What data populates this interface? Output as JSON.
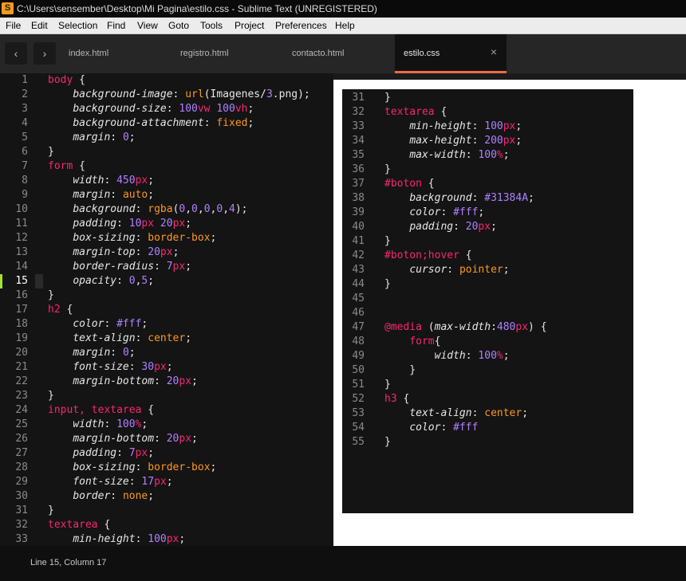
{
  "window": {
    "title": "C:\\Users\\sensember\\Desktop\\Mi Pagina\\estilo.css - Sublime Text (UNREGISTERED)",
    "icon": "sublime-icon"
  },
  "menu": [
    "File",
    "Edit",
    "Selection",
    "Find",
    "View",
    "Goto",
    "Tools",
    "Project",
    "Preferences",
    "Help"
  ],
  "nav": {
    "back": "‹",
    "forward": "›"
  },
  "tabs": [
    {
      "label": "index.html",
      "active": false
    },
    {
      "label": "registro.html",
      "active": false
    },
    {
      "label": "contacto.html",
      "active": false
    },
    {
      "label": "estilo.css",
      "active": true
    }
  ],
  "tab_close": "×",
  "editor": {
    "current_line": 15,
    "lines": [
      {
        "n": "1",
        "code": "body {"
      },
      {
        "n": "2",
        "code": "    background-image: url(Imagenes/3.png);"
      },
      {
        "n": "3",
        "code": "    background-size: 100vw 100vh;"
      },
      {
        "n": "4",
        "code": "    background-attachment: fixed;"
      },
      {
        "n": "5",
        "code": "    margin: 0;"
      },
      {
        "n": "6",
        "code": "}"
      },
      {
        "n": "7",
        "code": "form {"
      },
      {
        "n": "8",
        "code": "    width: 450px;"
      },
      {
        "n": "9",
        "code": "    margin: auto;"
      },
      {
        "n": "10",
        "code": "    background: rgba(0,0,0,0,4);"
      },
      {
        "n": "11",
        "code": "    padding: 10px 20px;"
      },
      {
        "n": "12",
        "code": "    box-sizing: border-box;"
      },
      {
        "n": "13",
        "code": "    margin-top: 20px;"
      },
      {
        "n": "14",
        "code": "    border-radius: 7px;"
      },
      {
        "n": "15",
        "code": "    opacity: 0,5;"
      },
      {
        "n": "16",
        "code": "}"
      },
      {
        "n": "17",
        "code": "h2 {"
      },
      {
        "n": "18",
        "code": "    color: #fff;"
      },
      {
        "n": "19",
        "code": "    text-align: center;"
      },
      {
        "n": "20",
        "code": "    margin: 0;"
      },
      {
        "n": "21",
        "code": "    font-size: 30px;"
      },
      {
        "n": "22",
        "code": "    margin-bottom: 20px;"
      },
      {
        "n": "23",
        "code": "}"
      },
      {
        "n": "24",
        "code": "input, textarea {"
      },
      {
        "n": "25",
        "code": "    width: 100%;"
      },
      {
        "n": "26",
        "code": "    margin-bottom: 20px;"
      },
      {
        "n": "27",
        "code": "    padding: 7px;"
      },
      {
        "n": "28",
        "code": "    box-sizing: border-box;"
      },
      {
        "n": "29",
        "code": "    font-size: 17px;"
      },
      {
        "n": "30",
        "code": "    border: none;"
      },
      {
        "n": "31",
        "code": "}"
      },
      {
        "n": "32",
        "code": "textarea {"
      },
      {
        "n": "33",
        "code": "    min-height: 100px;"
      }
    ]
  },
  "popup": {
    "lines": [
      {
        "n": "31",
        "code": "}"
      },
      {
        "n": "32",
        "code": "textarea {"
      },
      {
        "n": "33",
        "code": "    min-height: 100px;"
      },
      {
        "n": "34",
        "code": "    max-height: 200px;"
      },
      {
        "n": "35",
        "code": "    max-width: 100%;"
      },
      {
        "n": "36",
        "code": "}"
      },
      {
        "n": "37",
        "code": "#boton {"
      },
      {
        "n": "38",
        "code": "    background: #31384A;"
      },
      {
        "n": "39",
        "code": "    color: #fff;"
      },
      {
        "n": "40",
        "code": "    padding: 20px;"
      },
      {
        "n": "41",
        "code": "}"
      },
      {
        "n": "42",
        "code": "#boton;hover {"
      },
      {
        "n": "43",
        "code": "    cursor: pointer;"
      },
      {
        "n": "44",
        "code": "}"
      },
      {
        "n": "45",
        "code": ""
      },
      {
        "n": "46",
        "code": ""
      },
      {
        "n": "47",
        "code": "@media (max-width:480px) {"
      },
      {
        "n": "48",
        "code": "    form{"
      },
      {
        "n": "49",
        "code": "        width: 100%;"
      },
      {
        "n": "50",
        "code": "    }"
      },
      {
        "n": "51",
        "code": "}"
      },
      {
        "n": "52",
        "code": "h3 {"
      },
      {
        "n": "53",
        "code": "    text-align: center;"
      },
      {
        "n": "54",
        "code": "    color: #fff"
      },
      {
        "n": "55",
        "code": "}"
      }
    ]
  },
  "status": {
    "text": "Line 15, Column 17"
  },
  "colors": {
    "selector": "#f92672",
    "value": "#fd971f",
    "number": "#ae81ff",
    "active_tab_accent": "#ec6c43",
    "current_line_marker": "#a6e22e"
  }
}
